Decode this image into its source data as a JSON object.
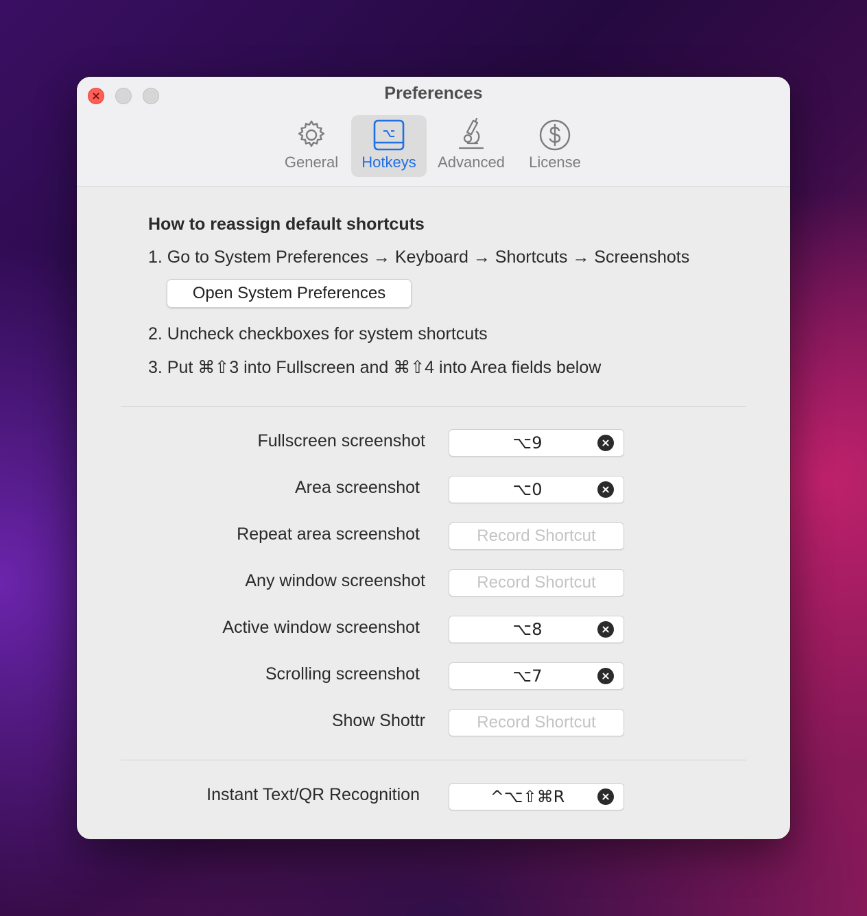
{
  "window": {
    "title": "Preferences"
  },
  "tabs": [
    {
      "label": "General",
      "icon": "gear-icon",
      "active": false
    },
    {
      "label": "Hotkeys",
      "icon": "keyboard-option-icon",
      "active": true
    },
    {
      "label": "Advanced",
      "icon": "microscope-icon",
      "active": false
    },
    {
      "label": "License",
      "icon": "dollar-circle-icon",
      "active": false
    }
  ],
  "instructions": {
    "title": "How to reassign default shortcuts",
    "step1": "1. Go to System Preferences → Keyboard → Shortcuts → Screenshots",
    "open_button": "Open System Preferences",
    "step2": "2. Uncheck checkboxes for system shortcuts",
    "step3": "3. Put ⌘⇧3 into Fullscreen and ⌘⇧4 into Area fields below"
  },
  "placeholder": "Record Shortcut",
  "shortcuts": [
    {
      "label": "Fullscreen screenshot",
      "value": "⌥9"
    },
    {
      "label": "Area screenshot",
      "value": "⌥0"
    },
    {
      "label": "Repeat area screenshot",
      "value": ""
    },
    {
      "label": "Any window screenshot",
      "value": ""
    },
    {
      "label": "Active window screenshot",
      "value": "⌥8"
    },
    {
      "label": "Scrolling screenshot",
      "value": "⌥7"
    },
    {
      "label": "Show Shottr",
      "value": ""
    }
  ],
  "recognition": {
    "label": "Instant Text/QR Recognition",
    "value": "^⌥⇧⌘R"
  },
  "colors": {
    "accent": "#1f6fe5",
    "close": "#ff5f57"
  }
}
